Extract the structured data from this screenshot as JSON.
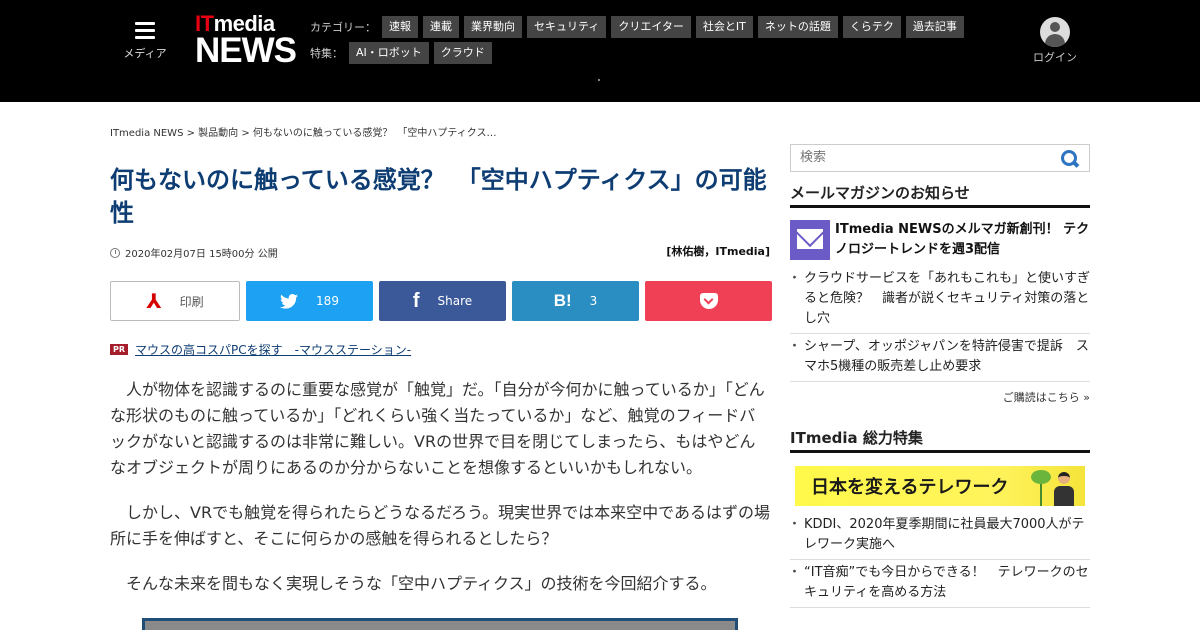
{
  "header": {
    "menu_label": "メディア",
    "logo_top": "media",
    "logo_it": "IT",
    "logo_news": "NEWS",
    "category_label": "カテゴリー：",
    "categories": [
      "速報",
      "連載",
      "業界動向",
      "セキュリティ",
      "クリエイター",
      "社会とIT",
      "ネットの話題",
      "くらテク",
      "過去記事"
    ],
    "feature_label": "特集：",
    "features": [
      "AI・ロボット",
      "クラウド"
    ],
    "login_label": "ログイン"
  },
  "article": {
    "breadcrumb": "ITmedia NEWS > 製品動向 > 何もないのに触っている感覚？　「空中ハプティクス…",
    "title": "何もないのに触っている感覚？　「空中ハプティクス」の可能性",
    "date": "2020年02月07日 15時00分 公開",
    "byline": "[林佑樹，ITmedia]",
    "share": {
      "print": "印刷",
      "twitter_count": "189",
      "facebook": "Share",
      "hatena_icon": "B!",
      "hatena_count": "3"
    },
    "pr_badge": "PR",
    "pr_link": "マウスの高コスパPCを探す　-マウスステーション-",
    "paragraphs": [
      "人が物体を認識するのに重要な感覚が「触覚」だ。「自分が今何かに触っているか」「どんな形状のものに触っているか」「どれくらい強く当たっているか」など、触覚のフィードバックがないと認識するのは非常に難しい。VRの世界で目を閉じてしまったら、もはやどんなオブジェクトが周りにあるのか分からないことを想像するといいかもしれない。",
      "しかし、VRでも触覚を得られたらどうなるだろう。現実世界では本来空中であるはずの場所に手を伸ばすと、そこに何らかの感触を得られるとしたら？",
      "そんな未来を間もなく実現しそうな「空中ハプティクス」の技術を今回紹介する。"
    ]
  },
  "sidebar": {
    "search_placeholder": "検索",
    "mail_heading": "メールマガジンのお知らせ",
    "mail_feature": "ITmedia NEWSのメルマガ新創刊！ テクノロジートレンドを週3配信",
    "mail_items": [
      "クラウドサービスを「あれもこれも」と使いすぎると危険？　識者が説くセキュリティ対策の落とし穴",
      "シャープ、オッポジャパンを特許侵害で提訴　スマホ5機種の販売差し止め要求"
    ],
    "mail_more": "ご購読はこちら »",
    "feature_heading": "ITmedia 総力特集",
    "banner_text": "日本を変えるテレワーク",
    "feature_items": [
      "KDDI、2020年夏季期間に社員最大7000人がテレワーク実施へ",
      "“IT音痴”でも今日からできる！　テレワークのセキュリティを高める方法"
    ]
  },
  "colors": {
    "header_bg": "#000000",
    "title": "#0e3d73",
    "twitter": "#1da1f2",
    "facebook": "#3b5998",
    "hatena": "#2a8ec2",
    "pocket": "#ef4056",
    "logo_red": "#e60012"
  }
}
